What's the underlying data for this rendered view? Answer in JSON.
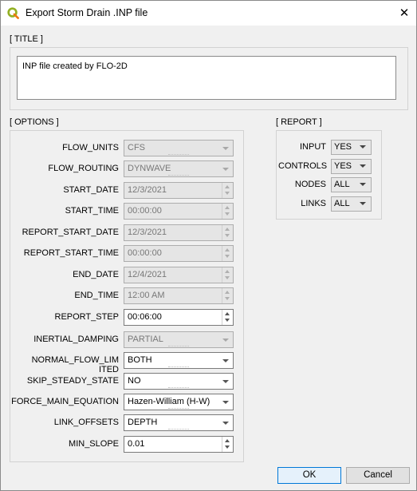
{
  "window": {
    "title": "Export Storm Drain .INP file",
    "close_glyph": "✕"
  },
  "title_section": {
    "label": "[ TITLE ]",
    "text": "INP file created by FLO-2D"
  },
  "options": {
    "label": "[ OPTIONS ]",
    "rows": [
      {
        "label": "FLOW_UNITS",
        "value": "CFS",
        "kind": "combo",
        "enabled": false
      },
      {
        "label": "FLOW_ROUTING",
        "value": "DYNWAVE",
        "kind": "combo",
        "enabled": false
      },
      {
        "label": "START_DATE",
        "value": "12/3/2021",
        "kind": "spin",
        "enabled": false
      },
      {
        "label": "START_TIME",
        "value": "00:00:00",
        "kind": "spin",
        "enabled": false
      },
      {
        "label": "REPORT_START_DATE",
        "value": "12/3/2021",
        "kind": "spin",
        "enabled": false
      },
      {
        "label": "REPORT_START_TIME",
        "value": "00:00:00",
        "kind": "spin",
        "enabled": false
      },
      {
        "label": "END_DATE",
        "value": "12/4/2021",
        "kind": "spin",
        "enabled": false
      },
      {
        "label": "END_TIME",
        "value": "12:00 AM",
        "kind": "spin",
        "enabled": false
      },
      {
        "label": "REPORT_STEP",
        "value": "00:06:00",
        "kind": "spin",
        "enabled": true
      },
      {
        "label": "INERTIAL_DAMPING",
        "value": "PARTIAL",
        "kind": "combo",
        "enabled": false
      },
      {
        "label": "NORMAL_FLOW_LIM ITED",
        "value": "BOTH",
        "kind": "combo",
        "enabled": true
      },
      {
        "label": "SKIP_STEADY_STATE",
        "value": "NO",
        "kind": "combo",
        "enabled": true
      },
      {
        "label": "FORCE_MAIN_EQUATION",
        "value": "Hazen-William (H-W)",
        "kind": "combo",
        "enabled": true
      },
      {
        "label": "LINK_OFFSETS",
        "value": "DEPTH",
        "kind": "combo",
        "enabled": true
      },
      {
        "label": "MIN_SLOPE",
        "value": "0.01",
        "kind": "spin",
        "enabled": true
      }
    ]
  },
  "report": {
    "label": "[ REPORT ]",
    "rows": [
      {
        "label": "INPUT",
        "value": "YES"
      },
      {
        "label": "CONTROLS",
        "value": "YES"
      },
      {
        "label": "NODES",
        "value": "ALL"
      },
      {
        "label": "LINKS",
        "value": "ALL"
      }
    ]
  },
  "buttons": {
    "ok": "OK",
    "cancel": "Cancel"
  }
}
